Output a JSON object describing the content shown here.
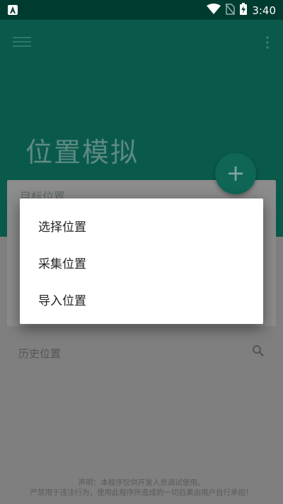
{
  "status_bar": {
    "time": "3:40",
    "icons": [
      "notification-a-icon",
      "wifi-icon",
      "no-sim-icon",
      "battery-charging-icon"
    ]
  },
  "app_bar": {
    "title": "位置模拟",
    "menu_icon": "hamburger-menu-icon",
    "more_icon": "more-vertical-icon",
    "fab_label": "+"
  },
  "card": {
    "title": "目标位置"
  },
  "history": {
    "label": "历史位置",
    "search_icon": "search-icon"
  },
  "disclaimer": {
    "line1": "声明：本程序仅供开发人员调试使用。",
    "line2": "严禁用于违法行为，使用此程序所造成的一切后果由用户自行承担！"
  },
  "dialog": {
    "items": [
      {
        "label": "选择位置"
      },
      {
        "label": "采集位置"
      },
      {
        "label": "导入位置"
      }
    ]
  },
  "colors": {
    "status_bar": "#003b30",
    "app_bar": "#0a5a4b",
    "dimmed_content": "#7f7f7f",
    "dialog_bg": "#ffffff"
  }
}
